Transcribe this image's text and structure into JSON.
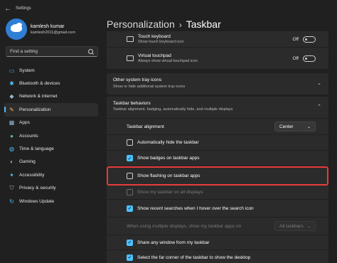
{
  "window": {
    "title": "Settings"
  },
  "profile": {
    "name": "kamlesh kumar",
    "email": "kamlesh2011@gmail.com"
  },
  "search": {
    "placeholder": "Find a setting"
  },
  "sidebar": {
    "items": [
      {
        "label": "System",
        "icon": "monitor-icon",
        "glyph": "▭",
        "color": "#4cc2ff"
      },
      {
        "label": "Bluetooth & devices",
        "icon": "bluetooth-icon",
        "glyph": "✱",
        "color": "#4cc2ff"
      },
      {
        "label": "Network & internet",
        "icon": "network-icon",
        "glyph": "◆",
        "color": "#8fb8d8"
      },
      {
        "label": "Personalization",
        "icon": "brush-icon",
        "glyph": "✎",
        "color": "#f0b45a"
      },
      {
        "label": "Apps",
        "icon": "apps-icon",
        "glyph": "▦",
        "color": "#8fb8d8"
      },
      {
        "label": "Accounts",
        "icon": "person-icon",
        "glyph": "●",
        "color": "#5fbf8a"
      },
      {
        "label": "Time & language",
        "icon": "globe-clock-icon",
        "glyph": "◍",
        "color": "#4cc2ff"
      },
      {
        "label": "Gaming",
        "icon": "gamepad-icon",
        "glyph": "◐",
        "color": "#b0b0b0"
      },
      {
        "label": "Accessibility",
        "icon": "accessibility-icon",
        "glyph": "✦",
        "color": "#4cc2ff"
      },
      {
        "label": "Privacy & security",
        "icon": "shield-icon",
        "glyph": "⛉",
        "color": "#b0b0b0"
      },
      {
        "label": "Windows Update",
        "icon": "update-icon",
        "glyph": "↻",
        "color": "#4cc2ff"
      }
    ],
    "active_index": 3
  },
  "header": {
    "parent": "Personalization",
    "current": "Taskbar"
  },
  "tray_items": [
    {
      "title": "Touch keyboard",
      "subtitle": "Show touch keyboard icon",
      "state": "Off"
    },
    {
      "title": "Virtual touchpad",
      "subtitle": "Always show virtual touchpad icon",
      "state": "Off"
    }
  ],
  "other_tray": {
    "title": "Other system tray icons",
    "subtitle": "Show or hide additional system tray icons"
  },
  "behaviors": {
    "title": "Taskbar behaviors",
    "subtitle": "Taskbar alignment, badging, automatically hide, and multiple displays",
    "alignment_label": "Taskbar alignment",
    "alignment_value": "Center",
    "checkboxes": [
      {
        "label": "Automatically hide the taskbar",
        "checked": false,
        "disabled": false
      },
      {
        "label": "Show badges on taskbar apps",
        "checked": true,
        "disabled": false
      },
      {
        "label": "Show flashing on taskbar apps",
        "checked": false,
        "disabled": false
      },
      {
        "label": "Show my taskbar on all displays",
        "checked": false,
        "disabled": true
      },
      {
        "label": "Show recent searches when I hover over the search icon",
        "checked": true,
        "disabled": false
      }
    ],
    "multi_display_label": "When using multiple displays, show my taskbar apps on",
    "multi_display_value": "All taskbars",
    "checkboxes_after": [
      {
        "label": "Share any window from my taskbar",
        "checked": true,
        "disabled": false
      },
      {
        "label": "Select the far corner of the taskbar to show the desktop",
        "checked": true,
        "disabled": false
      }
    ]
  },
  "colors": {
    "accent": "#4cc2ff",
    "highlight": "#e83b3b",
    "background": "#202020",
    "card": "#2b2b2b"
  }
}
